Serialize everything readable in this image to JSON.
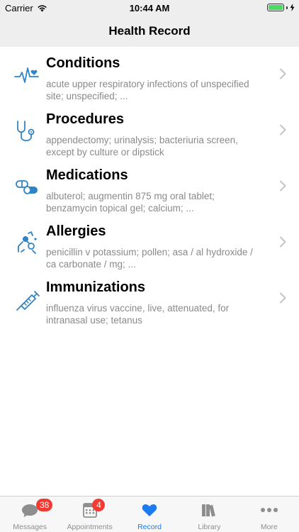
{
  "status_bar": {
    "carrier": "Carrier",
    "time": "10:44 AM",
    "battery_level": 1.0
  },
  "nav": {
    "title": "Health Record"
  },
  "records": [
    {
      "title": "Conditions",
      "description": "acute upper respiratory infections of unspecified site; unspecified; ...",
      "icon": "heart-pulse-icon"
    },
    {
      "title": "Procedures",
      "description": "appendectomy; urinalysis; bacteriuria screen, except by culture or dipstick",
      "icon": "stethoscope-icon"
    },
    {
      "title": "Medications",
      "description": "albuterol; augmentin 875 mg oral tablet; benzamycin topical gel; calcium; ...",
      "icon": "pills-icon"
    },
    {
      "title": "Allergies",
      "description": "penicillin v potassium; pollen; asa / al hydroxide / ca carbonate / mg; ...",
      "icon": "allergen-icon"
    },
    {
      "title": "Immunizations",
      "description": "influenza virus vaccine, live, attenuated, for intranasal use; tetanus",
      "icon": "syringe-icon"
    }
  ],
  "tabs": [
    {
      "label": "Messages",
      "badge": "38",
      "icon": "chat-bubble-icon"
    },
    {
      "label": "Appointments",
      "badge": "4",
      "icon": "calendar-icon"
    },
    {
      "label": "Record",
      "badge": "",
      "icon": "heart-icon",
      "active": true
    },
    {
      "label": "Library",
      "badge": "",
      "icon": "books-icon"
    },
    {
      "label": "More",
      "badge": "",
      "icon": "more-dots-icon"
    }
  ],
  "colors": {
    "accent": "#1d7bf2",
    "icon_blue": "#2f84c6",
    "badge": "#f03b34",
    "battery": "#4cd964",
    "description": "#8a8a8a"
  }
}
